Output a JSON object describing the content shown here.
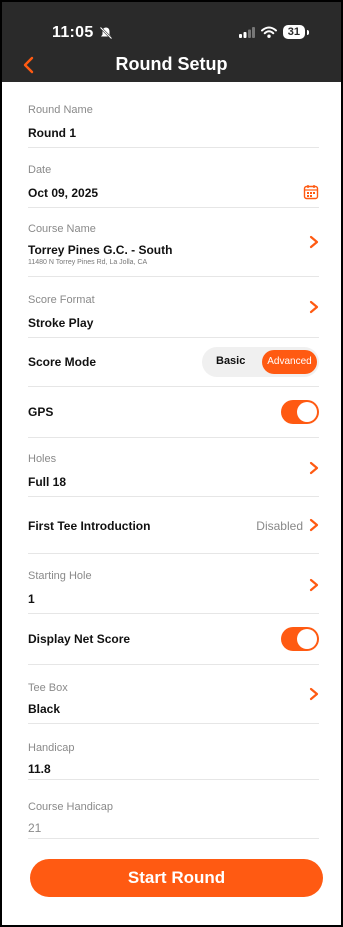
{
  "status_bar": {
    "time": "11:05",
    "battery": "31"
  },
  "header": {
    "title": "Round Setup"
  },
  "round_name": {
    "label": "Round Name",
    "value": "Round 1"
  },
  "date": {
    "label": "Date",
    "value": "Oct 09, 2025"
  },
  "course_name": {
    "label": "Course Name",
    "value": "Torrey Pines G.C. - South",
    "address": "11480 N Torrey Pines Rd, La Jolla, CA"
  },
  "score_format": {
    "label": "Score Format",
    "value": "Stroke Play"
  },
  "score_mode": {
    "label": "Score Mode",
    "options": [
      "Basic",
      "Advanced"
    ],
    "selected": "Advanced"
  },
  "gps": {
    "label": "GPS",
    "enabled": true
  },
  "holes": {
    "label": "Holes",
    "value": "Full 18"
  },
  "first_tee": {
    "label": "First Tee Introduction",
    "value": "Disabled"
  },
  "starting_hole": {
    "label": "Starting Hole",
    "value": "1"
  },
  "net_score": {
    "label": "Display Net Score",
    "enabled": true
  },
  "tee_box": {
    "label": "Tee Box",
    "value": "Black"
  },
  "handicap": {
    "label": "Handicap",
    "value": "11.8"
  },
  "course_handicap": {
    "label": "Course Handicap",
    "value": "21"
  },
  "start_button": {
    "label": "Start Round"
  },
  "colors": {
    "accent": "#ff5a12",
    "header_bg": "#2a2a2a"
  }
}
